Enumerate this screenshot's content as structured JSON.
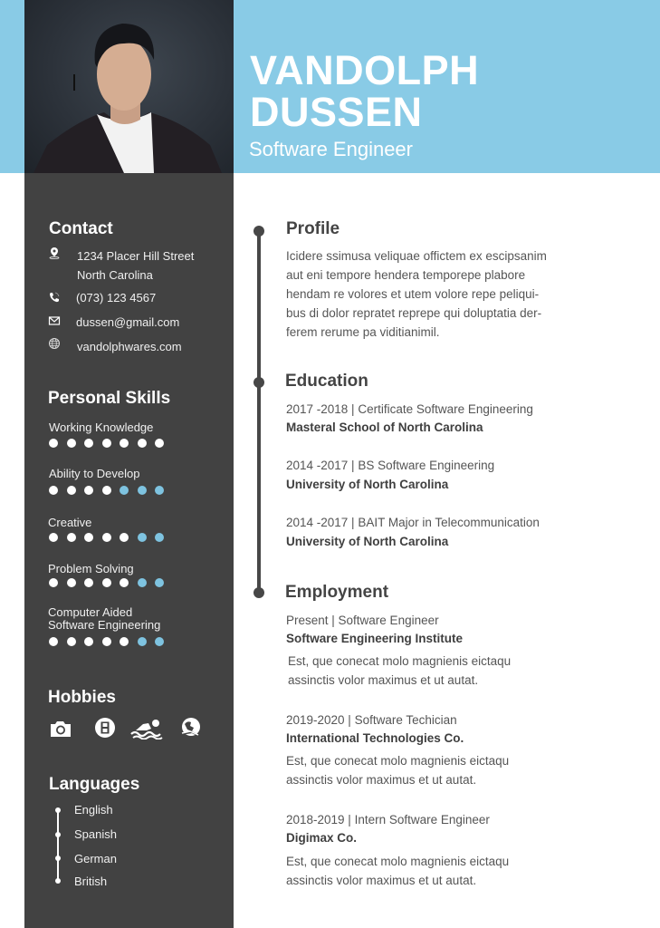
{
  "header": {
    "name_line1": "VANDOLPH",
    "name_line2": "DUSSEN",
    "title": "Software Engineer"
  },
  "colors": {
    "accent": "#89cbe6",
    "sidebar": "#424242",
    "skill_empty": "#7ec3e0",
    "heading_text": "#444444"
  },
  "contact": {
    "heading": "Contact",
    "items": [
      {
        "icon": "location-pin-icon",
        "lines": [
          "1234 Placer Hill Street",
          "North Carolina"
        ]
      },
      {
        "icon": "phone-icon",
        "lines": [
          "(073) 123 4567"
        ]
      },
      {
        "icon": "mail-icon",
        "lines": [
          "dussen@gmail.com"
        ]
      },
      {
        "icon": "globe-icon",
        "lines": [
          "vandolphwares.com"
        ]
      }
    ]
  },
  "skills": {
    "heading": "Personal Skills",
    "max": 7,
    "items": [
      {
        "label": "Working Knowledge",
        "level": 7
      },
      {
        "label": "Ability to Develop",
        "level": 4
      },
      {
        "label": "Creative",
        "level": 5
      },
      {
        "label": "Problem Solving",
        "level": 5
      },
      {
        "label": "Computer Aided Software Engineering",
        "label_lines": [
          "Computer Aided",
          "Software Engineering"
        ],
        "level": 5
      }
    ]
  },
  "hobbies": {
    "heading": "Hobbies",
    "icons": [
      "camera-icon",
      "film-icon",
      "swimming-icon",
      "travel-globe-icon"
    ]
  },
  "languages": {
    "heading": "Languages",
    "items": [
      "English",
      "Spanish",
      "German",
      "British"
    ]
  },
  "profile": {
    "heading": "Profile",
    "lines": [
      "Icidere ssimusa veliquae offictem ex escipsanim",
      "aut eni tempore hendera temporepe plabore",
      "hendam re volores et utem volore repe peliqui-",
      "bus di dolor repratet reprepe qui doluptatia der-",
      "ferem rerume pa viditianimil."
    ]
  },
  "education": {
    "heading": "Education",
    "items": [
      {
        "period": "2017 -2018 | Certificate Software Engineering",
        "school": "Masteral School of North Carolina"
      },
      {
        "period": "2014 -2017 | BS Software Engineering",
        "school": "University of North Carolina"
      },
      {
        "period": "2014 -2017 | BAIT Major in Telecommunication",
        "school": "University of North Carolina"
      }
    ]
  },
  "employment": {
    "heading": "Employment",
    "items": [
      {
        "period": "Present | Software Engineer",
        "company": "Software Engineering Institute",
        "desc": [
          "Est, que conecat molo magnienis eictaqu",
          "assinctis volor maximus et ut autat."
        ]
      },
      {
        "period": "2019-2020 | Software Techician",
        "company": "International Technologies Co.",
        "desc": [
          "Est, que conecat molo magnienis eictaqu",
          "assinctis volor maximus et ut autat."
        ]
      },
      {
        "period": "2018-2019 | Intern Software Engineer",
        "company": "Digimax Co.",
        "desc": [
          "Est, que conecat molo magnienis eictaqu",
          "assinctis volor maximus et ut autat."
        ]
      }
    ]
  }
}
